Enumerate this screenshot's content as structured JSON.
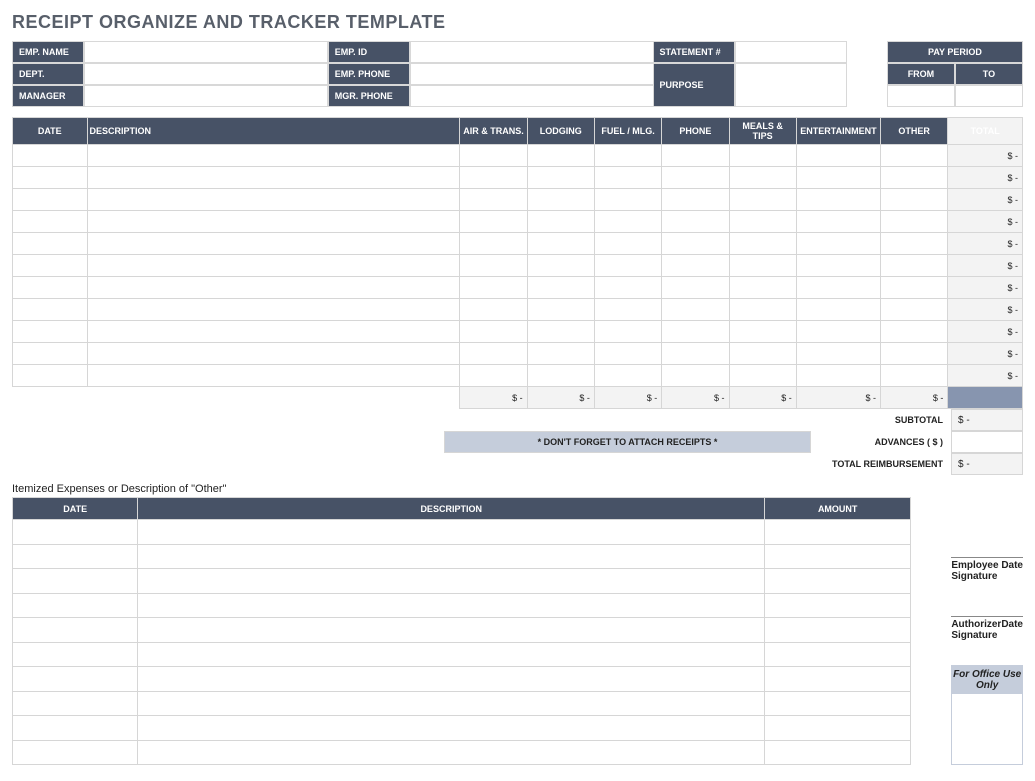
{
  "title": "RECEIPT ORGANIZE AND TRACKER TEMPLATE",
  "info": {
    "emp_name_label": "EMP. NAME",
    "emp_name": "",
    "emp_id_label": "EMP. ID",
    "emp_id": "",
    "dept_label": "DEPT.",
    "dept": "",
    "emp_phone_label": "EMP. PHONE",
    "emp_phone": "",
    "manager_label": "MANAGER",
    "manager": "",
    "mgr_phone_label": "MGR. PHONE",
    "mgr_phone": "",
    "statement_label": "STATEMENT #",
    "statement": "",
    "purpose_label": "PURPOSE",
    "purpose": "",
    "pay_period_label": "PAY PERIOD",
    "from_label": "FROM",
    "to_label": "TO",
    "from": "",
    "to": ""
  },
  "expense": {
    "headers": {
      "date": "DATE",
      "description": "DESCRIPTION",
      "air_trans": "AIR & TRANS.",
      "lodging": "LODGING",
      "fuel_mlg": "FUEL / MLG.",
      "phone": "PHONE",
      "meals_tips": "MEALS & TIPS",
      "entertainment": "ENTERTAINMENT",
      "other": "OTHER",
      "total": "TOTAL"
    },
    "row_total_display": "$          -",
    "column_total_display": "$          -",
    "num_rows": 11
  },
  "reminder": "* DON'T FORGET TO ATTACH RECEIPTS *",
  "summary": {
    "subtotal_label": "SUBTOTAL",
    "subtotal": "$          -",
    "advances_label": "ADVANCES  ( $ )",
    "advances": "",
    "reimb_label": "TOTAL REIMBURSEMENT",
    "reimb": "$          -"
  },
  "itemized": {
    "section_label": "Itemized Expenses or Description of \"Other\"",
    "headers": {
      "date": "DATE",
      "description": "DESCRIPTION",
      "amount": "AMOUNT"
    },
    "num_rows": 10
  },
  "signatures": {
    "emp_sig": "Employee Signature",
    "auth_sig": "Authorizer Signature",
    "date": "Date"
  },
  "office": {
    "header": "For Office Use Only"
  }
}
